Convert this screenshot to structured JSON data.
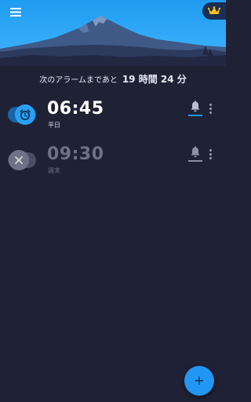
{
  "colors": {
    "background": "#1f2135",
    "sky_top": "#1e9bf0",
    "sky_bottom": "#3fb4ff",
    "accent": "#2196f3",
    "crown": "#ffc21a",
    "disabled_text": "#6e7286"
  },
  "header": {
    "menu_icon": "hamburger-menu-icon",
    "premium_icon": "crown-icon"
  },
  "next_alarm": {
    "label": "次のアラームまであと",
    "value": "19 時間 24 分"
  },
  "alarms": [
    {
      "time": "06:45",
      "days": "平日",
      "enabled": true,
      "toggle_icon": "alarm-clock-icon",
      "sound_icon": "bell-icon",
      "menu_icon": "more-vertical-icon"
    },
    {
      "time": "09:30",
      "days": "週末",
      "enabled": false,
      "toggle_icon": "close-icon",
      "sound_icon": "bell-icon",
      "menu_icon": "more-vertical-icon"
    }
  ],
  "fab": {
    "label": "+",
    "icon": "plus-icon"
  }
}
